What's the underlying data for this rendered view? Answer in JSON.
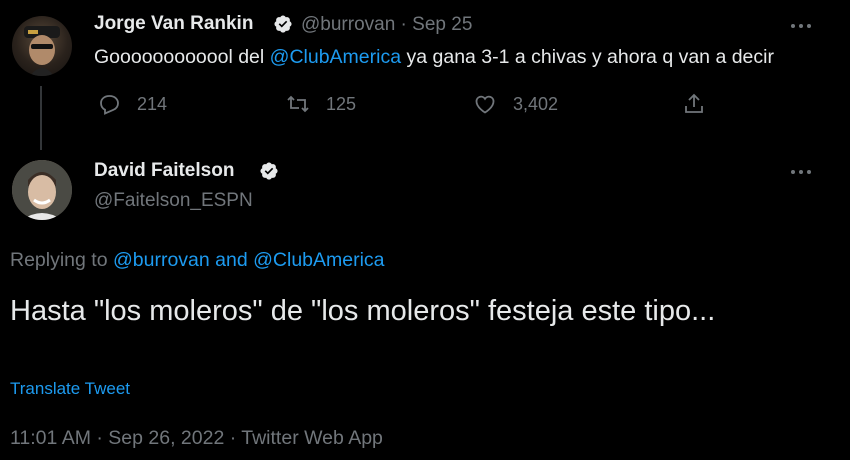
{
  "colors": {
    "background": "#000000",
    "text_primary": "#e7e9ea",
    "text_secondary": "#71767b",
    "accent": "#1d9bf0",
    "thread_line": "#333639"
  },
  "parent_tweet": {
    "author_name": "Jorge Van Rankin",
    "handle_and_date": "@burrovan · Sep 25",
    "text_before": "Goooooooooool del ",
    "mention": "@ClubAmerica",
    "text_after": " ya gana 3-1 a chivas y ahora q van a decir",
    "reply_count": "214",
    "retweet_count": "125",
    "like_count": "3,402",
    "icons": [
      "verified-icon",
      "more-icon",
      "reply-icon",
      "retweet-icon",
      "like-icon",
      "share-icon"
    ]
  },
  "main_tweet": {
    "author_name": "David Faitelson",
    "handle": "@Faitelson_ESPN",
    "replying_prefix": "Replying to ",
    "replying_mentions": "@burrovan and @ClubAmerica",
    "text": "Hasta \"los moleros\" de \"los moleros\" festeja este tipo...",
    "translate_label": "Translate Tweet",
    "meta": "11:01 AM · Sep 26, 2022 · Twitter Web App"
  }
}
